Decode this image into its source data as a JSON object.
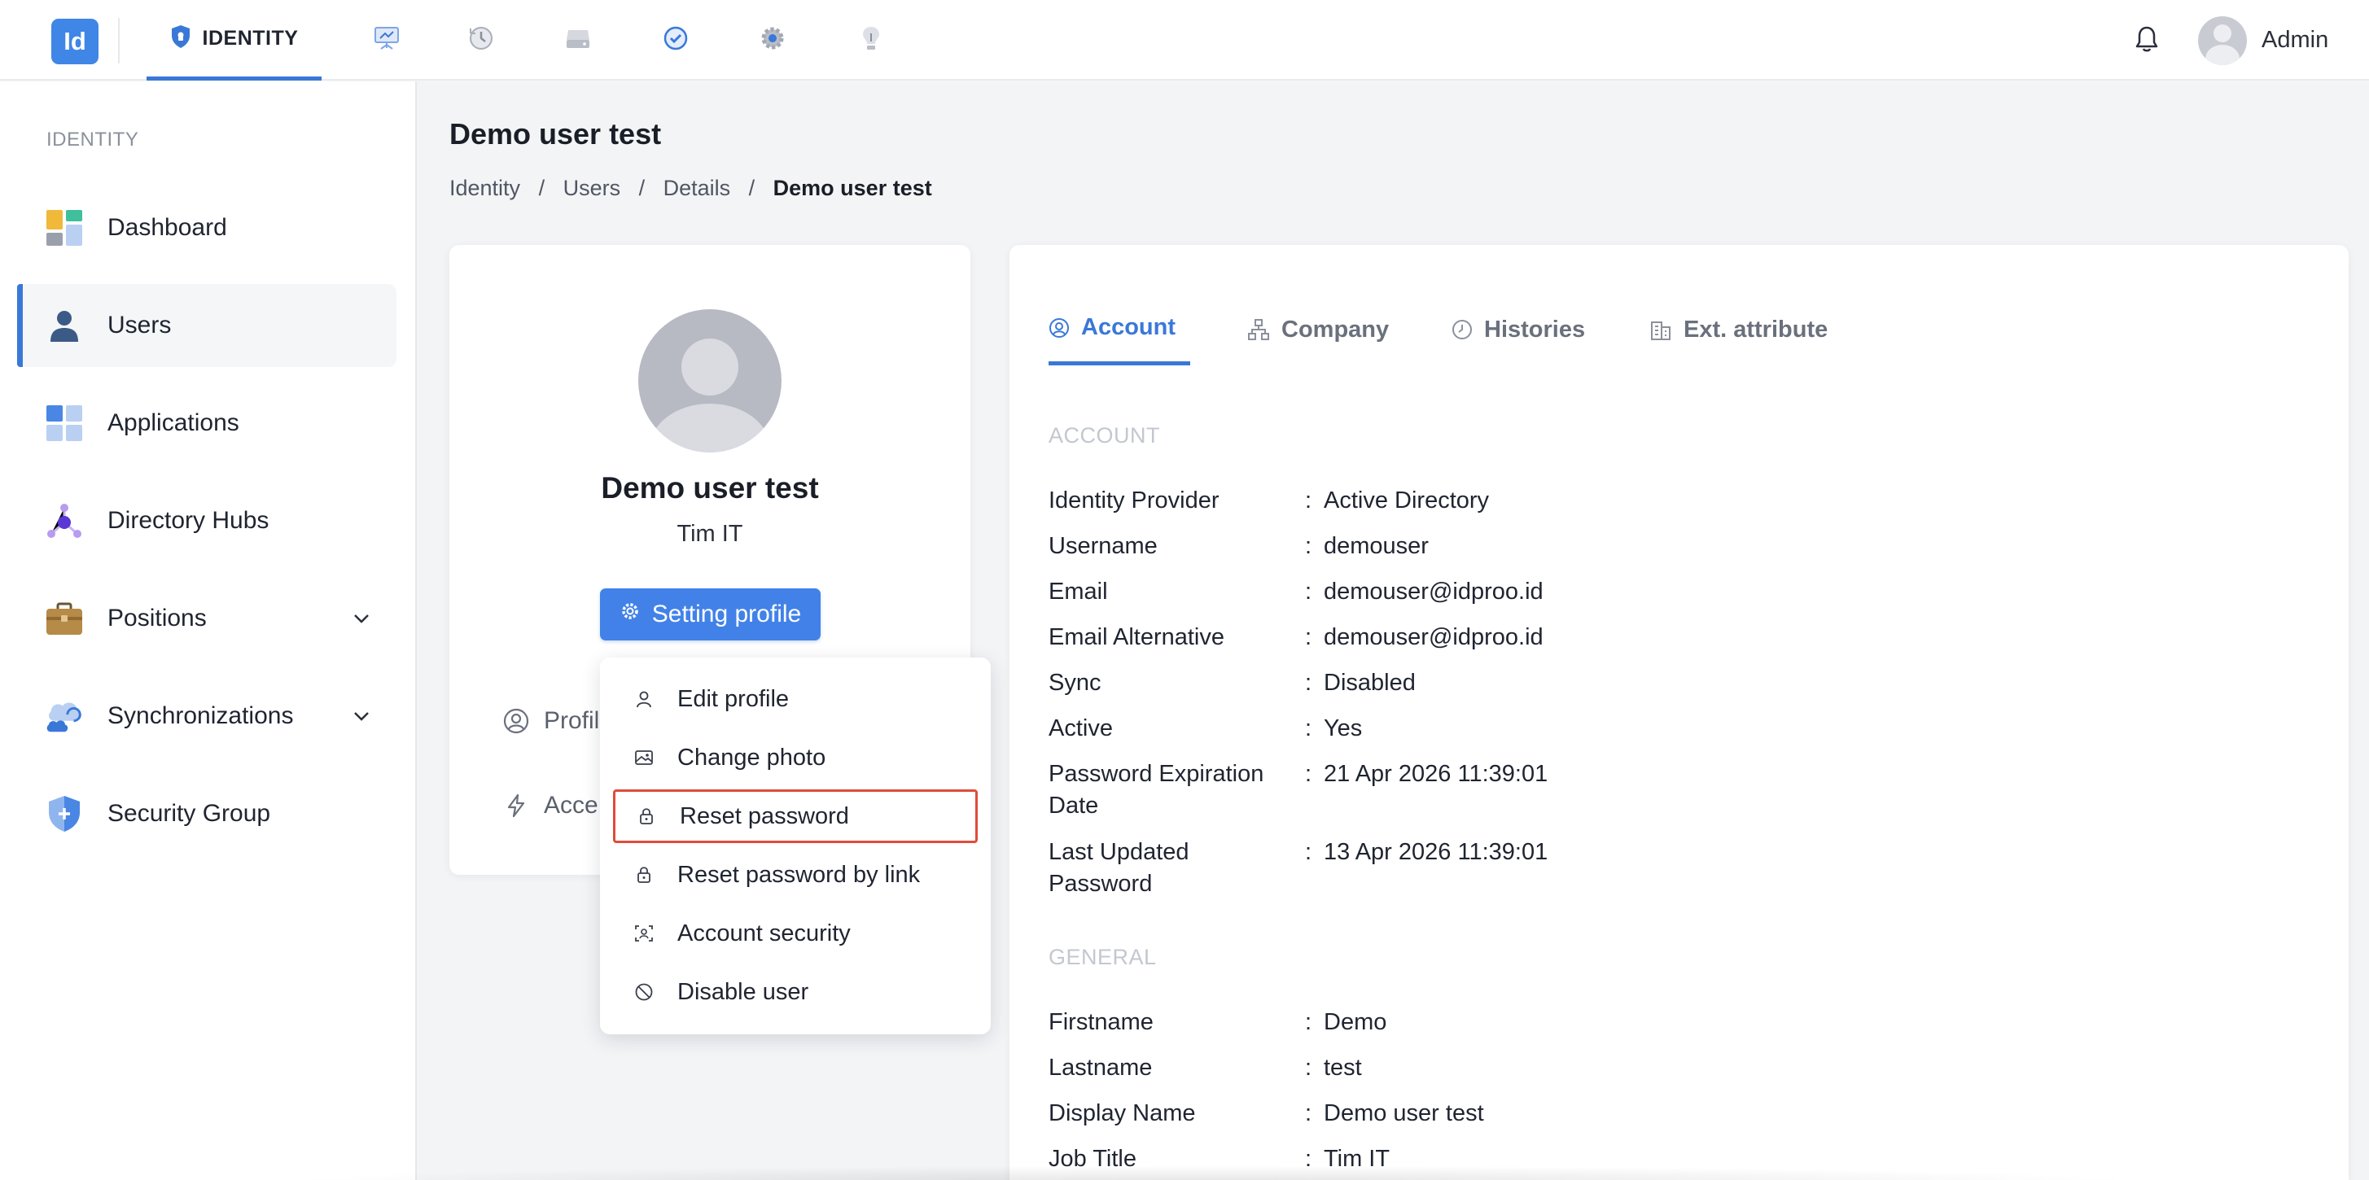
{
  "topbar": {
    "logo": "Id",
    "active_tab": "IDENTITY",
    "icons": [
      "monitor-icon",
      "history-icon",
      "storage-icon",
      "check-badge-icon",
      "gear-icon",
      "lightbulb-icon"
    ],
    "user": "Admin"
  },
  "sidebar": {
    "section": "IDENTITY",
    "items": [
      {
        "label": "Dashboard"
      },
      {
        "label": "Users"
      },
      {
        "label": "Applications"
      },
      {
        "label": "Directory Hubs"
      },
      {
        "label": "Positions"
      },
      {
        "label": "Synchronizations"
      },
      {
        "label": "Security Group"
      }
    ]
  },
  "page": {
    "title": "Demo user test",
    "breadcrumb": [
      "Identity",
      "Users",
      "Details",
      "Demo user test"
    ]
  },
  "profile": {
    "name": "Demo user test",
    "subtitle": "Tim IT",
    "setting_button": "Setting profile",
    "link_profile": "Profil",
    "link_access": "Acce"
  },
  "dropdown": {
    "items": [
      {
        "label": "Edit profile"
      },
      {
        "label": "Change photo"
      },
      {
        "label": "Reset password"
      },
      {
        "label": "Reset password by link"
      },
      {
        "label": "Account security"
      },
      {
        "label": "Disable user"
      }
    ]
  },
  "details": {
    "tabs": [
      {
        "label": "Account"
      },
      {
        "label": "Company"
      },
      {
        "label": "Histories"
      },
      {
        "label": "Ext. attribute"
      }
    ],
    "account_section": "ACCOUNT",
    "account": [
      {
        "key": "Identity Provider",
        "value": "Active Directory"
      },
      {
        "key": "Username",
        "value": "demouser"
      },
      {
        "key": "Email",
        "value": "demouser@idproo.id"
      },
      {
        "key": "Email Alternative",
        "value": "demouser@idproo.id"
      },
      {
        "key": "Sync",
        "value": "Disabled"
      },
      {
        "key": "Active",
        "value": "Yes"
      },
      {
        "key": "Password Expiration Date",
        "value": "21 Apr 2026 11:39:01"
      },
      {
        "key": "Last Updated Password",
        "value": "13 Apr 2026 11:39:01"
      }
    ],
    "general_section": "GENERAL",
    "general": [
      {
        "key": "Firstname",
        "value": "Demo"
      },
      {
        "key": "Lastname",
        "value": "test"
      },
      {
        "key": "Display Name",
        "value": "Demo user test"
      },
      {
        "key": "Job Title",
        "value": "Tim IT"
      }
    ],
    "separator": ":"
  }
}
